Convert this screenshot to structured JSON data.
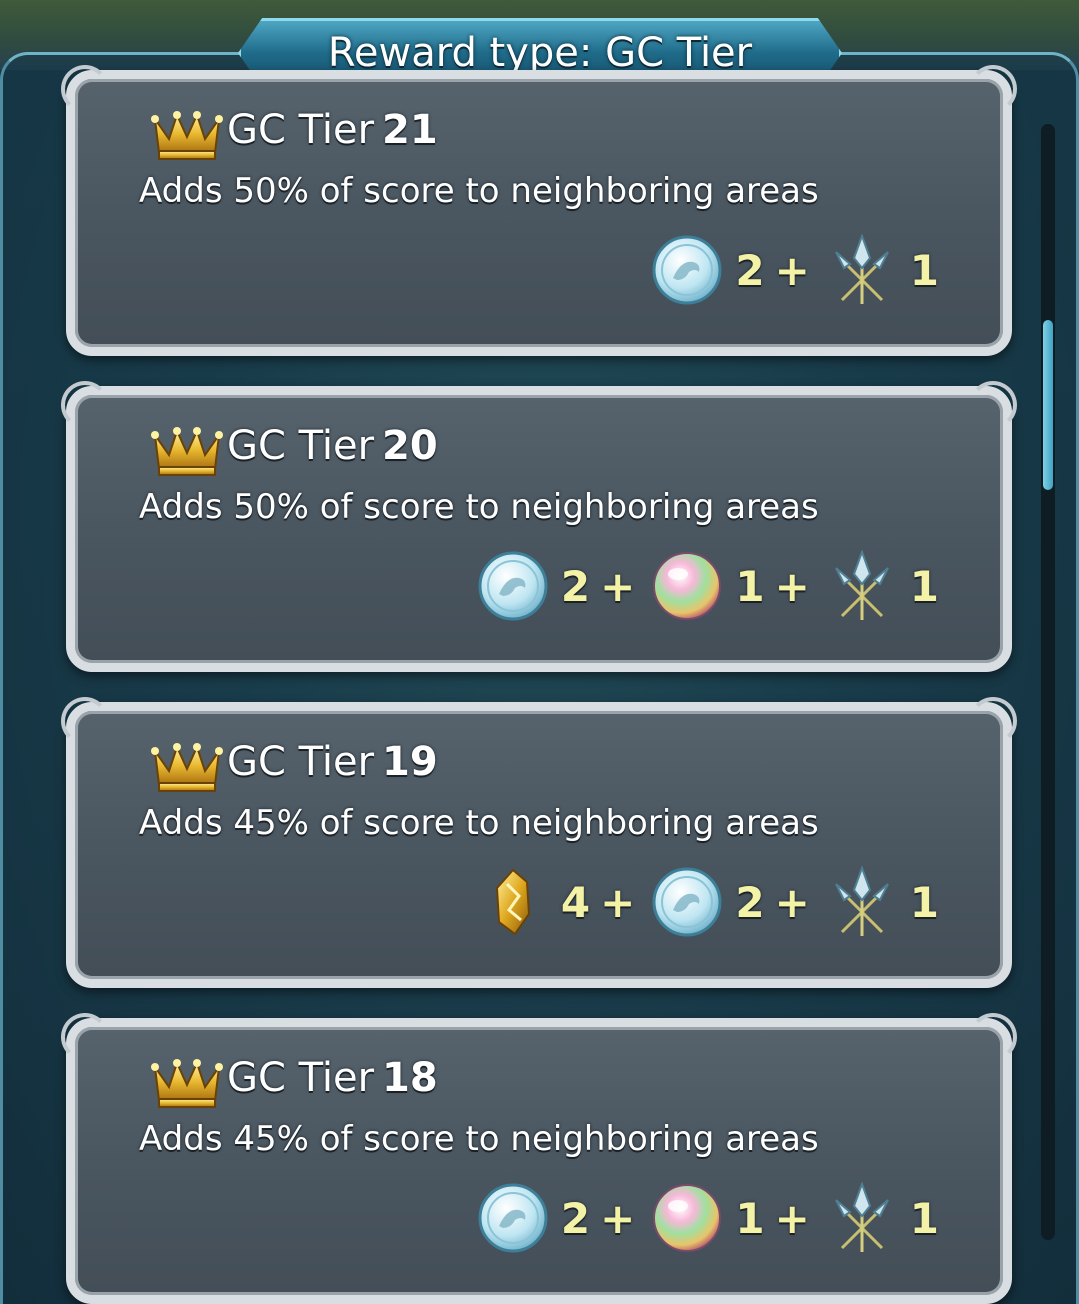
{
  "header": {
    "title": "Reward type: GC Tier"
  },
  "tiers": [
    {
      "label": "GC Tier",
      "number": "21",
      "description": "Adds 50% of score to neighboring areas",
      "rewards": [
        {
          "icon": "badge-coin-icon",
          "qty": "2"
        },
        {
          "icon": "sacred-seal-spear-icon",
          "qty": "1"
        }
      ]
    },
    {
      "label": "GC Tier",
      "number": "20",
      "description": "Adds 50% of score to neighboring areas",
      "rewards": [
        {
          "icon": "badge-coin-icon",
          "qty": "2"
        },
        {
          "icon": "orb-icon",
          "qty": "1"
        },
        {
          "icon": "sacred-seal-spear-icon",
          "qty": "1"
        }
      ]
    },
    {
      "label": "GC Tier",
      "number": "19",
      "description": "Adds 45% of score to neighboring areas",
      "rewards": [
        {
          "icon": "gold-crystal-icon",
          "qty": "4"
        },
        {
          "icon": "badge-coin-icon",
          "qty": "2"
        },
        {
          "icon": "sacred-seal-spear-icon",
          "qty": "1"
        }
      ]
    },
    {
      "label": "GC Tier",
      "number": "18",
      "description": "Adds 45% of score to neighboring areas",
      "rewards": [
        {
          "icon": "badge-coin-icon",
          "qty": "2"
        },
        {
          "icon": "orb-icon",
          "qty": "1"
        },
        {
          "icon": "sacred-seal-spear-icon",
          "qty": "1"
        }
      ]
    }
  ],
  "plus_sign": "+",
  "colors": {
    "quantity": "#f3f2a6",
    "accent": "#8fd9ec",
    "panel": "#4a5660"
  }
}
